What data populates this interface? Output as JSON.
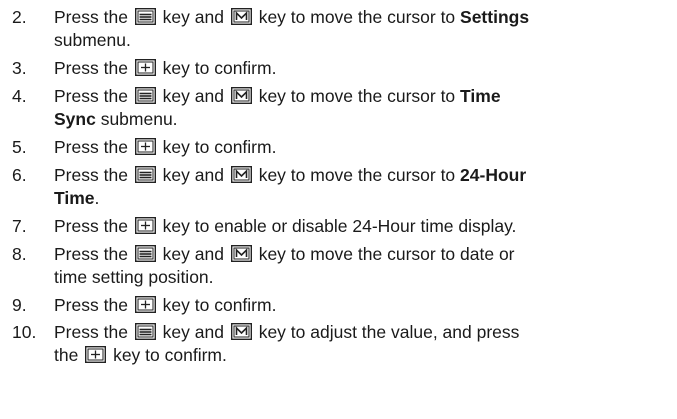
{
  "steps": [
    {
      "num": "2.",
      "lines": [
        {
          "segments": [
            {
              "t": "Press the "
            },
            {
              "key": "menu-key"
            },
            {
              "t": " key and "
            },
            {
              "key": "m-key"
            },
            {
              "t": " key to move the cursor to "
            },
            {
              "t": "Settings",
              "b": true
            }
          ]
        },
        {
          "segments": [
            {
              "t": "submenu."
            }
          ]
        }
      ]
    },
    {
      "num": "3.",
      "lines": [
        {
          "segments": [
            {
              "t": "Press the "
            },
            {
              "key": "plus-key"
            },
            {
              "t": " key to confirm."
            }
          ]
        }
      ]
    },
    {
      "num": "4.",
      "lines": [
        {
          "segments": [
            {
              "t": "Press the "
            },
            {
              "key": "menu-key"
            },
            {
              "t": " key and "
            },
            {
              "key": "m-key"
            },
            {
              "t": " key to move the cursor to "
            },
            {
              "t": "Time",
              "b": true
            }
          ]
        },
        {
          "segments": [
            {
              "t": "Sync",
              "b": true
            },
            {
              "t": " submenu."
            }
          ]
        }
      ]
    },
    {
      "num": "5.",
      "lines": [
        {
          "segments": [
            {
              "t": "Press the "
            },
            {
              "key": "plus-key"
            },
            {
              "t": " key to confirm."
            }
          ]
        }
      ]
    },
    {
      "num": "6.",
      "lines": [
        {
          "segments": [
            {
              "t": "Press the "
            },
            {
              "key": "menu-key"
            },
            {
              "t": " key and "
            },
            {
              "key": "m-key"
            },
            {
              "t": " key to move the cursor to "
            },
            {
              "t": "24-Hour",
              "b": true
            }
          ]
        },
        {
          "segments": [
            {
              "t": "Time",
              "b": true
            },
            {
              "t": "."
            }
          ]
        }
      ]
    },
    {
      "num": "7.",
      "lines": [
        {
          "segments": [
            {
              "t": "Press the "
            },
            {
              "key": "plus-key"
            },
            {
              "t": " key to enable or disable 24-Hour time display."
            }
          ]
        }
      ]
    },
    {
      "num": "8.",
      "lines": [
        {
          "segments": [
            {
              "t": "Press the "
            },
            {
              "key": "menu-key"
            },
            {
              "t": " key and "
            },
            {
              "key": "m-key"
            },
            {
              "t": " key to move the cursor to date or"
            }
          ]
        },
        {
          "segments": [
            {
              "t": "time setting position."
            }
          ]
        }
      ]
    },
    {
      "num": "9.",
      "lines": [
        {
          "segments": [
            {
              "t": "Press the "
            },
            {
              "key": "plus-key"
            },
            {
              "t": " key to confirm."
            }
          ]
        }
      ]
    },
    {
      "num": "10.",
      "lines": [
        {
          "segments": [
            {
              "t": "Press the "
            },
            {
              "key": "menu-key"
            },
            {
              "t": " key and "
            },
            {
              "key": "m-key"
            },
            {
              "t": " key to adjust the value, and press"
            }
          ]
        },
        {
          "segments": [
            {
              "t": "the "
            },
            {
              "key": "plus-key"
            },
            {
              "t": " key to confirm."
            }
          ]
        }
      ]
    }
  ]
}
